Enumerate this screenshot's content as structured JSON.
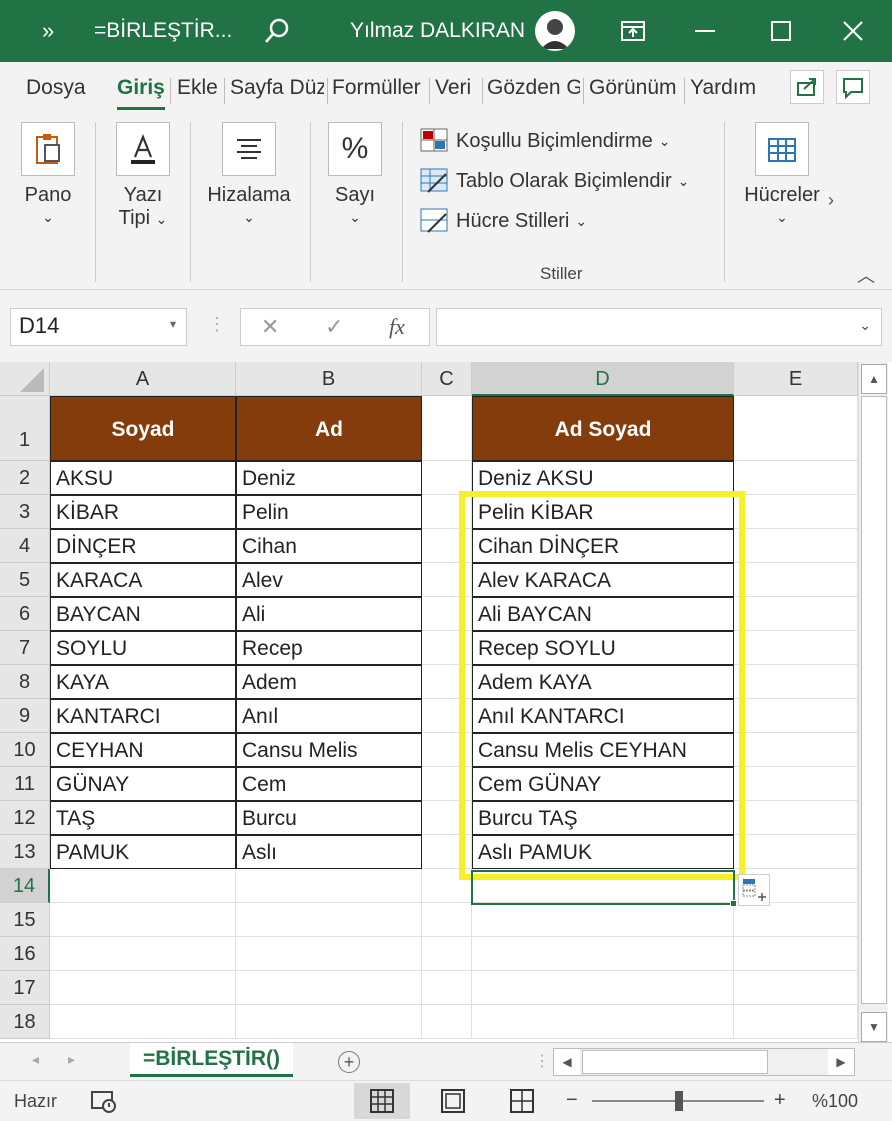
{
  "window": {
    "more_glyph": "»",
    "document_title": "=BİRLEŞTİR...",
    "user_name": "Yılmaz DALKIRAN"
  },
  "ribbon_tabs": [
    "Dosya",
    "Giriş",
    "Ekle",
    "Sayfa Düz",
    "Formüller",
    "Veri",
    "Gözden G",
    "Görünüm",
    "Yardım"
  ],
  "active_tab": "Giriş",
  "ribbon": {
    "pano": "Pano",
    "yazi_tipi_1": "Yazı",
    "yazi_tipi_2": "Tipi",
    "hizalama": "Hizalama",
    "sayi": "Sayı",
    "kosullu": "Koşullu Biçimlendirme",
    "tablo": "Tablo Olarak Biçimlendir",
    "hucre_stilleri": "Hücre Stilleri",
    "stiller": "Stiller",
    "hucreler": "Hücreler"
  },
  "formula_bar": {
    "name_box": "D14",
    "formula": ""
  },
  "columns": [
    "A",
    "B",
    "C",
    "D",
    "E"
  ],
  "rows": [
    "1",
    "2",
    "3",
    "4",
    "5",
    "6",
    "7",
    "8",
    "9",
    "10",
    "11",
    "12",
    "13",
    "14",
    "15",
    "16",
    "17",
    "18"
  ],
  "table_headers": {
    "soyad": "Soyad",
    "ad": "Ad",
    "ad_soyad": "Ad Soyad"
  },
  "data_rows": [
    {
      "soyad": "AKSU",
      "ad": "Deniz",
      "ad_soyad": "Deniz AKSU"
    },
    {
      "soyad": "KİBAR",
      "ad": "Pelin",
      "ad_soyad": "Pelin KİBAR"
    },
    {
      "soyad": "DİNÇER",
      "ad": "Cihan",
      "ad_soyad": "Cihan DİNÇER"
    },
    {
      "soyad": "KARACA",
      "ad": "Alev",
      "ad_soyad": "Alev KARACA"
    },
    {
      "soyad": "BAYCAN",
      "ad": "Ali",
      "ad_soyad": "Ali BAYCAN"
    },
    {
      "soyad": "SOYLU",
      "ad": "Recep",
      "ad_soyad": "Recep SOYLU"
    },
    {
      "soyad": "KAYA",
      "ad": "Adem",
      "ad_soyad": "Adem KAYA"
    },
    {
      "soyad": "KANTARCI",
      "ad": "Anıl",
      "ad_soyad": "Anıl KANTARCI"
    },
    {
      "soyad": "CEYHAN",
      "ad": "Cansu Melis",
      "ad_soyad": "Cansu Melis CEYHAN"
    },
    {
      "soyad": "GÜNAY",
      "ad": "Cem",
      "ad_soyad": "Cem GÜNAY"
    },
    {
      "soyad": "TAŞ",
      "ad": "Burcu",
      "ad_soyad": "Burcu TAŞ"
    },
    {
      "soyad": "PAMUK",
      "ad": "Aslı",
      "ad_soyad": "Aslı PAMUK"
    }
  ],
  "sheet_tab": "=BİRLEŞTİR()",
  "status": {
    "ready": "Hazır",
    "zoom": "%100",
    "zoom_level_percent": 100
  },
  "selection": {
    "column": "D",
    "row": "14"
  },
  "colors": {
    "accent": "#217346",
    "header_fill": "#843c0c",
    "highlight": "#f5f02a"
  },
  "icons": [
    "search-icon",
    "avatar",
    "restore-icon",
    "maximize-icon",
    "close-icon",
    "share-icon",
    "comment-icon",
    "clipboard-icon",
    "font-icon",
    "align-icon",
    "percent-icon",
    "conditional-format-icon",
    "table-format-icon",
    "cell-styles-icon",
    "cells-icon"
  ]
}
